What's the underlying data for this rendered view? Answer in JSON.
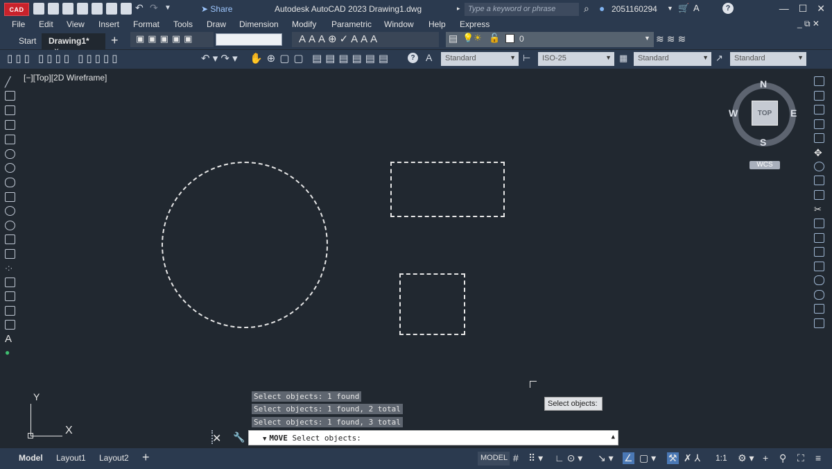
{
  "window": {
    "logo_text": "CAD",
    "title": "Autodesk AutoCAD 2023    Drawing1.dwg",
    "share_label": "Share",
    "search_placeholder": "Type a keyword or phrase",
    "username": "2051160294"
  },
  "menu": {
    "items": [
      "File",
      "Edit",
      "View",
      "Insert",
      "Format",
      "Tools",
      "Draw",
      "Dimension",
      "Modify",
      "Parametric",
      "Window",
      "Help",
      "Express"
    ]
  },
  "tabs": {
    "start": "Start",
    "drawing": "Drawing1*",
    "close": "×",
    "add": "+"
  },
  "layer": {
    "current": "0"
  },
  "styles": {
    "text_style": "Standard",
    "dim_style": "ISO-25",
    "table_style": "Standard",
    "multileader_style": "Standard"
  },
  "viewport": {
    "label": "[−][Top][2D Wireframe]"
  },
  "viewcube": {
    "top": "TOP",
    "north": "N",
    "south": "S",
    "east": "E",
    "west": "W",
    "wcs": "WCS"
  },
  "ucs": {
    "x": "X",
    "y": "Y"
  },
  "command": {
    "history": [
      "Select objects: 1 found",
      "Select objects: 1 found, 2 total",
      "Select objects: 1 found, 3 total"
    ],
    "current_command": "MOVE",
    "prompt": "Select objects:"
  },
  "tooltip": {
    "text": "Select objects:"
  },
  "statusbar": {
    "layout_tabs": [
      "Model",
      "Layout1",
      "Layout2"
    ],
    "add": "+",
    "model_button": "MODEL",
    "scale": "1:1"
  }
}
